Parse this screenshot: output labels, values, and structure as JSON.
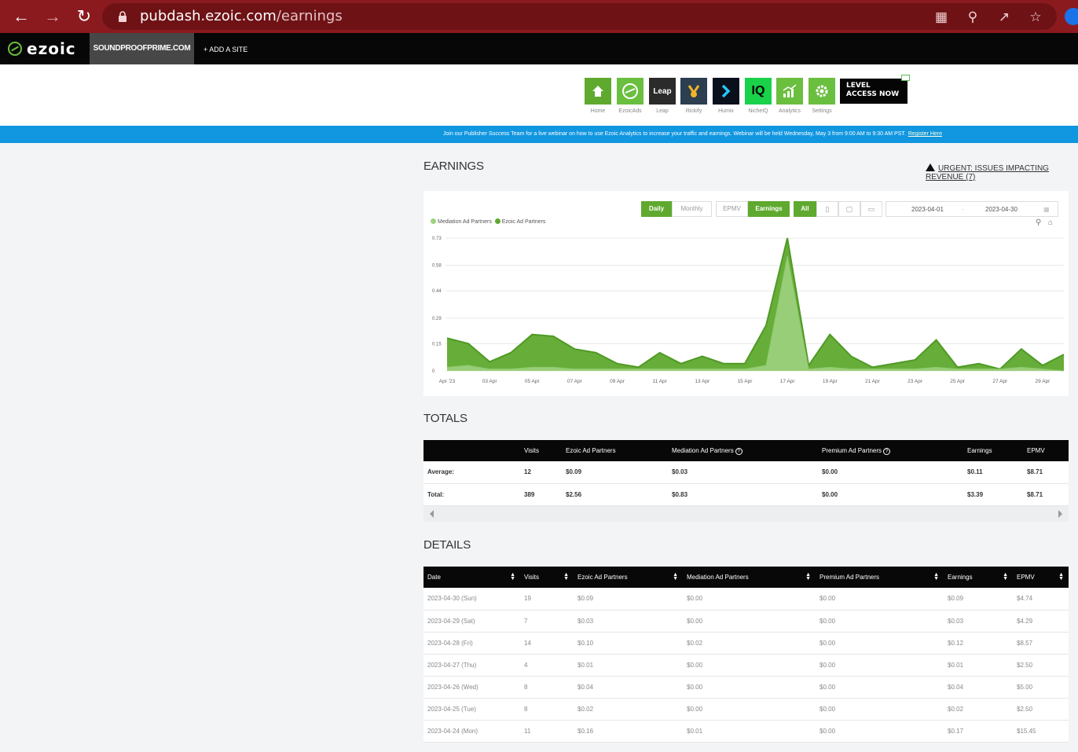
{
  "browser": {
    "url_host": "pubdash.ezoic.com",
    "url_path": "/earnings"
  },
  "topnav": {
    "logo": "ezoic",
    "site": "SOUNDPROOFPRIME.COM",
    "add_site": "+ ADD A SITE"
  },
  "apps": [
    {
      "label": "Home",
      "icon": "home-icon",
      "color": "#5fa92f"
    },
    {
      "label": "EzoicAds",
      "icon": "ezoic-ads-icon",
      "color": "#6abf3f"
    },
    {
      "label": "Leap",
      "icon": "leap-icon",
      "color": "#2b2b2b"
    },
    {
      "label": "Rickify",
      "icon": "rickify-icon",
      "color": "#2c3e50"
    },
    {
      "label": "Humix",
      "icon": "humix-icon",
      "color": "#0a0f1c"
    },
    {
      "label": "NicheIQ",
      "icon": "nicheiq-icon",
      "color": "#1ad14a"
    },
    {
      "label": "Analytics",
      "icon": "analytics-icon",
      "color": "#6abf3f"
    },
    {
      "label": "Settings",
      "icon": "gear-icon",
      "color": "#6abf3f"
    }
  ],
  "app_tiles": {
    "leap": "Leap",
    "iq": "IQ"
  },
  "level_access": {
    "line1": "LEVEL",
    "line2": "ACCESS NOW"
  },
  "announcement": {
    "text": "Join our Publisher Success Team for a live webinar on how to use Ezoic Analytics to increase your traffic and earnings. Webinar will be held Wednesday, May 3 from 9:00 AM to 9:30 AM PST.",
    "link": "Register Here"
  },
  "earnings": {
    "title": "EARNINGS",
    "urgent": "URGENT: ISSUES IMPACTING REVENUE (7)",
    "toggles": {
      "daily": "Daily",
      "monthly": "Monthly",
      "epmv": "EPMV",
      "earnings": "Earnings",
      "all": "All"
    },
    "date_start": "2023-04-01",
    "date_sep": "-",
    "date_end": "2023-04-30"
  },
  "chart_data": {
    "type": "area",
    "x": [
      "Apr '23",
      "02 Apr",
      "03 Apr",
      "04 Apr",
      "05 Apr",
      "06 Apr",
      "07 Apr",
      "08 Apr",
      "09 Apr",
      "10 Apr",
      "11 Apr",
      "12 Apr",
      "13 Apr",
      "14 Apr",
      "15 Apr",
      "16 Apr",
      "17 Apr",
      "18 Apr",
      "19 Apr",
      "20 Apr",
      "21 Apr",
      "22 Apr",
      "23 Apr",
      "24 Apr",
      "25 Apr",
      "26 Apr",
      "27 Apr",
      "28 Apr",
      "29 Apr",
      "30 Apr"
    ],
    "x_tick_labels": [
      "Apr '23",
      "03 Apr",
      "05 Apr",
      "07 Apr",
      "09 Apr",
      "11 Apr",
      "13 Apr",
      "15 Apr",
      "17 Apr",
      "19 Apr",
      "21 Apr",
      "23 Apr",
      "25 Apr",
      "27 Apr",
      "29 Apr"
    ],
    "y_ticks": [
      "0",
      "0.15",
      "0.29",
      "0.44",
      "0.58",
      "0.73"
    ],
    "ylim": [
      0,
      0.73
    ],
    "legend_position": "top-left",
    "series": [
      {
        "name": "Ezoic Ad Partners",
        "color": "#5fa92f",
        "values": [
          0.18,
          0.15,
          0.05,
          0.1,
          0.2,
          0.19,
          0.12,
          0.1,
          0.04,
          0.02,
          0.1,
          0.04,
          0.08,
          0.04,
          0.04,
          0.25,
          0.73,
          0.03,
          0.2,
          0.08,
          0.02,
          0.04,
          0.06,
          0.17,
          0.02,
          0.04,
          0.01,
          0.12,
          0.03,
          0.09
        ]
      },
      {
        "name": "Mediation Ad Partners",
        "color": "#9fd27f",
        "values": [
          0.02,
          0.03,
          0.01,
          0.01,
          0.02,
          0.02,
          0.01,
          0.01,
          0.01,
          0.01,
          0.01,
          0.01,
          0.01,
          0.01,
          0.01,
          0.03,
          0.63,
          0.01,
          0.02,
          0.01,
          0.01,
          0.01,
          0.01,
          0.02,
          0.01,
          0.01,
          0.01,
          0.02,
          0.01,
          0.0
        ]
      }
    ]
  },
  "totals": {
    "title": "TOTALS",
    "headers": [
      "",
      "Visits",
      "Ezoic Ad Partners",
      "Mediation Ad Partners",
      "Premium Ad Partners",
      "Earnings",
      "EPMV"
    ],
    "rows": [
      [
        "Average:",
        "12",
        "$0.09",
        "$0.03",
        "$0.00",
        "$0.11",
        "$8.71"
      ],
      [
        "Total:",
        "389",
        "$2.56",
        "$0.83",
        "$0.00",
        "$3.39",
        "$8.71"
      ]
    ]
  },
  "details": {
    "title": "DETAILS",
    "headers": [
      "Date",
      "Visits",
      "Ezoic Ad Partners",
      "Mediation Ad Partners",
      "Premium Ad Partners",
      "Earnings",
      "EPMV"
    ],
    "rows": [
      [
        "2023-04-30 (Sun)",
        "19",
        "$0.09",
        "$0.00",
        "$0.00",
        "$0.09",
        "$4.74"
      ],
      [
        "2023-04-29 (Sat)",
        "7",
        "$0.03",
        "$0.00",
        "$0.00",
        "$0.03",
        "$4.29"
      ],
      [
        "2023-04-28 (Fri)",
        "14",
        "$0.10",
        "$0.02",
        "$0.00",
        "$0.12",
        "$8.57"
      ],
      [
        "2023-04-27 (Thu)",
        "4",
        "$0.01",
        "$0.00",
        "$0.00",
        "$0.01",
        "$2.50"
      ],
      [
        "2023-04-26 (Wed)",
        "8",
        "$0.04",
        "$0.00",
        "$0.00",
        "$0.04",
        "$5.00"
      ],
      [
        "2023-04-25 (Tue)",
        "8",
        "$0.02",
        "$0.00",
        "$0.00",
        "$0.02",
        "$2.50"
      ],
      [
        "2023-04-24 (Mon)",
        "11",
        "$0.16",
        "$0.01",
        "$0.00",
        "$0.17",
        "$15.45"
      ]
    ]
  }
}
